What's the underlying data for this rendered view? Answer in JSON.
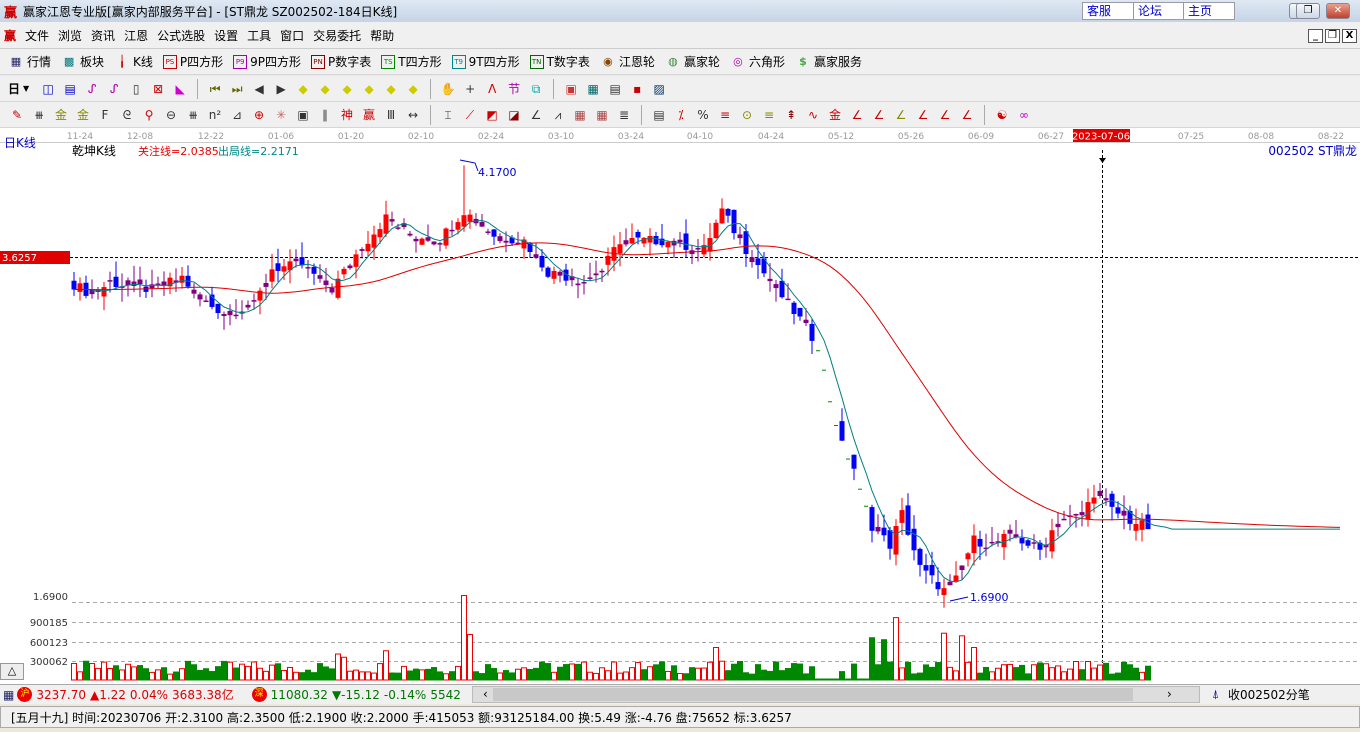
{
  "window": {
    "title": "赢家江恩专业版[赢家内部服务平台] - [ST鼎龙  SZ002502-184日K线]",
    "logo": "赢",
    "links": [
      "客服",
      "论坛",
      "主页"
    ]
  },
  "menu": [
    "文件",
    "浏览",
    "资讯",
    "江恩",
    "公式选股",
    "设置",
    "工具",
    "窗口",
    "交易委托",
    "帮助"
  ],
  "toolbar1": [
    {
      "icon": "grid-icon",
      "label": "行情"
    },
    {
      "icon": "blocks-icon",
      "label": "板块"
    },
    {
      "icon": "kline-icon",
      "label": "K线"
    },
    {
      "icon": "PS",
      "label": "P四方形"
    },
    {
      "icon": "P9",
      "label": "9P四方形"
    },
    {
      "icon": "PN",
      "label": "P数字表"
    },
    {
      "icon": "TS",
      "label": "T四方形"
    },
    {
      "icon": "T9",
      "label": "9T四方形"
    },
    {
      "icon": "TN",
      "label": "T数字表"
    },
    {
      "icon": "gann-wheel-icon",
      "label": "江恩轮"
    },
    {
      "icon": "winner-wheel-icon",
      "label": "赢家轮"
    },
    {
      "icon": "hexagon-icon",
      "label": "六角形"
    },
    {
      "icon": "dollar-icon",
      "label": "赢家服务"
    }
  ],
  "toolbar2": {
    "period": "日"
  },
  "chart": {
    "period_label": "日K线",
    "indicator_name": "乾坤K线",
    "focus_line": "关注线=2.0385",
    "exit_line": "出局线=2.2171",
    "stock_label": "002502 ST鼎龙",
    "cursor_price": "3.6257",
    "cursor_date": "2023-07-06",
    "high_label": "4.1700",
    "low_label": "1.6900",
    "low_axis": "1.6900",
    "dates": [
      "11-24",
      "12-08",
      "12-22",
      "01-06",
      "01-20",
      "02-10",
      "02-24",
      "03-10",
      "03-24",
      "04-10",
      "04-24",
      "05-12",
      "05-26",
      "06-09",
      "06-27",
      "07-25",
      "08-08",
      "08-22"
    ],
    "volume_axis": [
      "900185",
      "600123",
      "300062"
    ],
    "colors": {
      "up": "#ff0000",
      "down": "#0000ff",
      "neutral": "#800080",
      "ma_fast": "#008080",
      "ma_slow": "#dd0000"
    }
  },
  "chart_data": {
    "type": "candlestick",
    "title": "ST鼎龙 日K线",
    "y_range": [
      1.69,
      4.17
    ],
    "close_keypoints": [
      [
        0,
        3.47
      ],
      [
        3,
        3.41
      ],
      [
        6,
        3.48
      ],
      [
        13,
        3.44
      ],
      [
        18,
        3.51
      ],
      [
        21,
        3.38
      ],
      [
        25,
        3.31
      ],
      [
        30,
        3.35
      ],
      [
        33,
        3.56
      ],
      [
        38,
        3.58
      ],
      [
        43,
        3.44
      ],
      [
        47,
        3.64
      ],
      [
        52,
        3.85
      ],
      [
        56,
        3.75
      ],
      [
        61,
        3.73
      ],
      [
        65,
        3.89
      ],
      [
        70,
        3.75
      ],
      [
        75,
        3.72
      ],
      [
        79,
        3.54
      ],
      [
        85,
        3.49
      ],
      [
        88,
        3.55
      ],
      [
        91,
        3.72
      ],
      [
        98,
        3.72
      ],
      [
        105,
        3.67
      ],
      [
        108,
        3.89
      ],
      [
        112,
        3.67
      ],
      [
        116,
        3.49
      ],
      [
        121,
        3.27
      ],
      [
        124,
        3.12
      ],
      [
        126,
        2.81
      ],
      [
        128,
        2.55
      ],
      [
        130,
        2.42
      ],
      [
        131,
        2.28
      ],
      [
        133,
        2.09
      ],
      [
        136,
        1.98
      ],
      [
        138,
        2.16
      ],
      [
        141,
        1.85
      ],
      [
        145,
        1.72
      ],
      [
        147,
        1.78
      ],
      [
        150,
        2.01
      ],
      [
        153,
        1.98
      ],
      [
        156,
        2.04
      ],
      [
        161,
        1.95
      ],
      [
        164,
        2.12
      ],
      [
        168,
        2.15
      ],
      [
        170,
        2.28
      ],
      [
        173,
        2.18
      ],
      [
        176,
        2.12
      ],
      [
        179,
        2.08
      ]
    ]
  },
  "status": {
    "sh_icon": "沪",
    "sh": "3237.70",
    "sh_chg": "▲1.22",
    "sh_pct": "0.04%",
    "sh_amt": "3683.38亿",
    "sz_icon": "深",
    "sz": "11080.32",
    "sz_chg": "▼-15.12",
    "sz_pct": "-0.14%",
    "sz_amt": "5542.38",
    "tick": "收002502分笔"
  },
  "info": "[五月十九] 时间:20230706 开:2.3100 高:2.3500 低:2.1900 收:2.2000 手:415053 额:93125184.00 换:5.49 涨:-4.76 盘:75652 标:3.6257"
}
